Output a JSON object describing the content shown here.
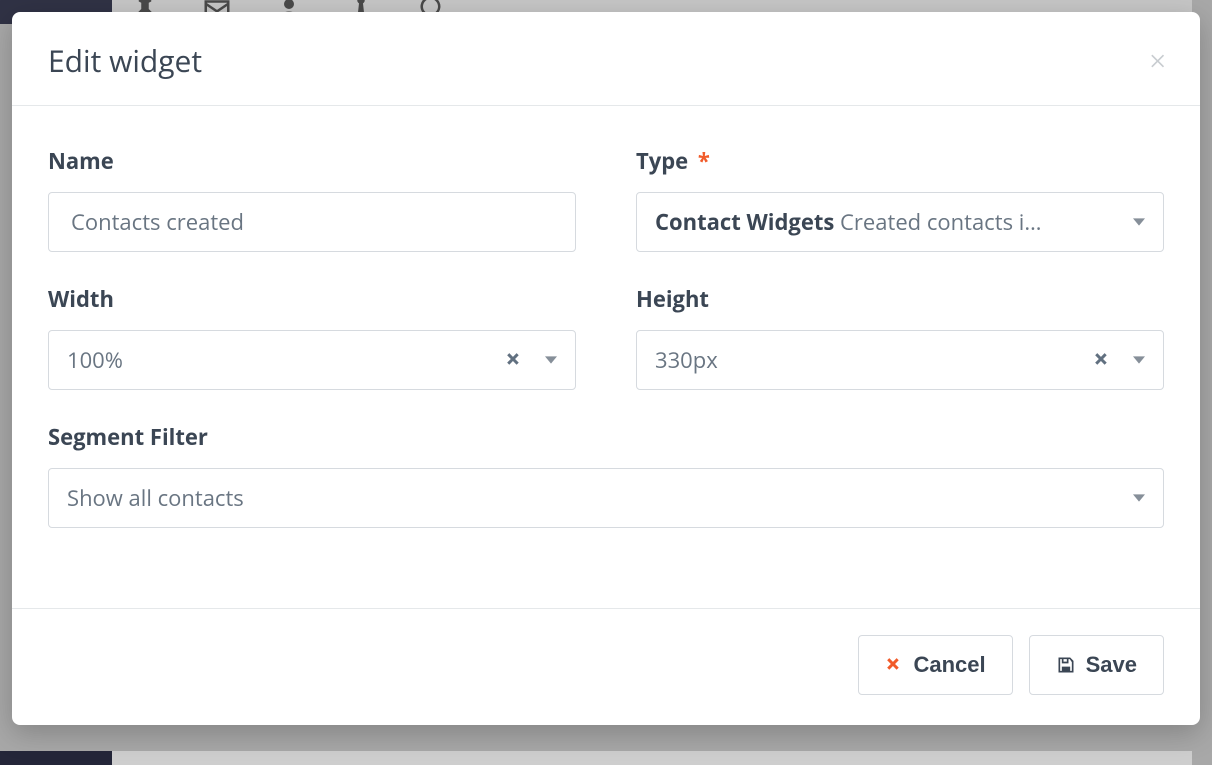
{
  "modal": {
    "title": "Edit widget",
    "fields": {
      "name": {
        "label": "Name",
        "value": "Contacts created"
      },
      "type": {
        "label": "Type",
        "required_marker": "*",
        "group": "Contact Widgets",
        "option": " Created contacts i…"
      },
      "width": {
        "label": "Width",
        "value": "100%"
      },
      "height": {
        "label": "Height",
        "value": "330px"
      },
      "segment": {
        "label": "Segment Filter",
        "value": "Show all contacts"
      }
    },
    "footer": {
      "cancel": "Cancel",
      "save": "Save"
    }
  }
}
